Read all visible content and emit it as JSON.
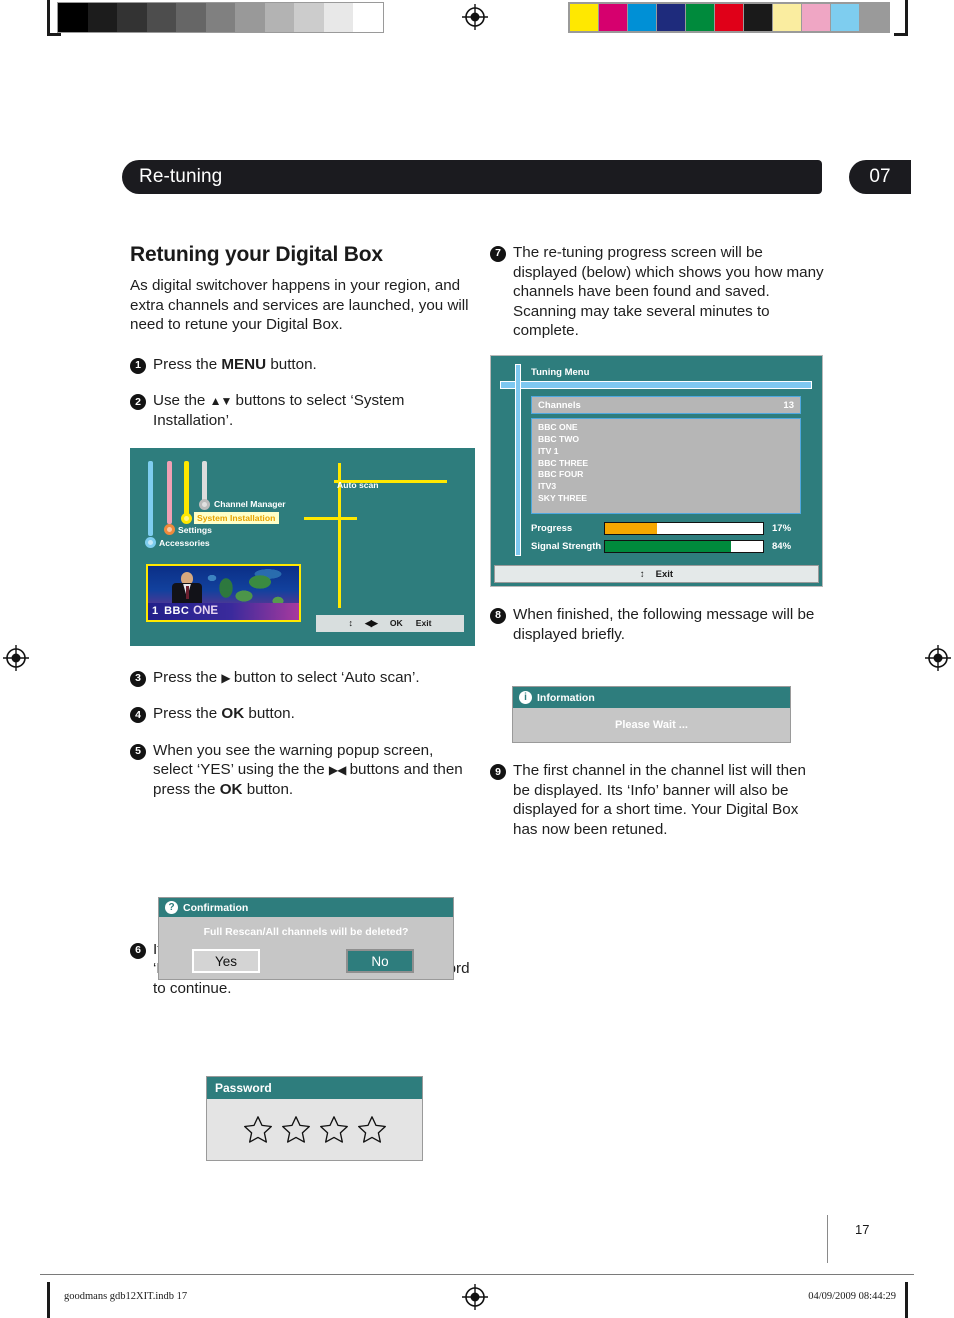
{
  "calibration": {
    "grayscale": [
      "#000000",
      "#1c1c1c",
      "#333333",
      "#4d4d4d",
      "#666666",
      "#808080",
      "#999999",
      "#b3b3b3",
      "#cccccc",
      "#e8e8e8",
      "#ffffff"
    ],
    "colors": [
      "#ffe800",
      "#d6006e",
      "#0090d6",
      "#1e2b7c",
      "#008a3c",
      "#e00018",
      "#1a1a1a",
      "#faeda0",
      "#efa6c4",
      "#7ecdef",
      "#9a9a9a"
    ]
  },
  "header": {
    "title": "Re-tuning",
    "page_badge": "07"
  },
  "left": {
    "section_title": "Retuning your Digital Box",
    "intro": "As digital switchover happens in your region, and extra channels and services are launched, you will need to retune your Digital Box.",
    "steps": [
      {
        "num": "1",
        "text_1": "Press the ",
        "bold": "MENU",
        "text_2": " button."
      },
      {
        "num": "2",
        "text_1": "Use the ",
        "glyphs": "▲▼",
        "text_2": " buttons to select ‘System Installation’."
      },
      {
        "num": "3",
        "text_1": "Press the ",
        "glyphs": "▶",
        "text_2": " button to select ‘Auto scan’."
      },
      {
        "num": "4",
        "text_1": "Press the ",
        "bold": "OK",
        "text_2": " button."
      },
      {
        "num": "5",
        "text_1": "When you see the warning popup screen, select ‘YES’ using the the ",
        "glyphs": "▶◀",
        "text_2": " buttons and then press the ",
        "bold": "OK",
        "text_3": " button."
      },
      {
        "num": "6",
        "text_1": "If ‘ Parental Lock has been set to ‘On’, the ‘Password’ box will display. Enter the password to continue."
      }
    ]
  },
  "osd_menu": {
    "items": [
      {
        "label": "Channel Manager",
        "selected": false,
        "bar_color": "#dcdcdc",
        "knob_color": "#bcbcbc"
      },
      {
        "label": "System Installation",
        "selected": true,
        "bar_color": "#ffe800",
        "knob_color": "#ffe800"
      },
      {
        "label": "Settings",
        "selected": false,
        "bar_color": "#f0a0b4",
        "knob_color": "#f08a3c"
      },
      {
        "label": "Accessories",
        "selected": false,
        "bar_color": "#7ecdef",
        "knob_color": "#7ecdef"
      }
    ],
    "submenu": "Auto scan",
    "navbar": {
      "updown": "↕",
      "leftright": "◀▶",
      "ok": "OK",
      "exit": "Exit"
    },
    "thumbnail": {
      "channel_number": "1",
      "brand": "BBC",
      "channel": "ONE"
    },
    "bg_color": "#2e7d7d",
    "highlight_bg": "#ffffc8",
    "highlight_fg": "#e8a200"
  },
  "confirmation": {
    "icon": "question-icon",
    "title": "Confirmation",
    "message": "Full Rescan/All channels will be deleted?",
    "yes_label": "Yes",
    "no_label": "No",
    "selected": "No"
  },
  "password": {
    "title": "Password",
    "digits": [
      "☆",
      "☆",
      "☆",
      "☆"
    ],
    "digit_count": 4
  },
  "right": {
    "steps": [
      {
        "num": "7",
        "text": "The re-tuning progress screen will be displayed (below) which shows you how many channels have been found and saved. Scanning may take several minutes to complete."
      },
      {
        "num": "8",
        "text": "When finished, the following message will be displayed briefly."
      },
      {
        "num": "9",
        "text": "The first channel in the channel list will then be displayed. Its ‘Info’ banner will also be displayed for a short time. Your Digital Box has now been retuned."
      }
    ]
  },
  "tuning_menu": {
    "title": "Tuning Menu",
    "channels_label": "Channels",
    "channels_count": "13",
    "channel_list": [
      "BBC ONE",
      "BBC TWO",
      "ITV 1",
      "BBC THREE",
      "BBC FOUR",
      "ITV3",
      "SKY THREE"
    ],
    "progress": {
      "label": "Progress",
      "value": "17%",
      "fill_fraction": 0.33,
      "color": "#f5a700"
    },
    "signal": {
      "label": "Signal Strength",
      "value": "84%",
      "fill_fraction": 0.8,
      "color": "#008a3c"
    },
    "exit_label": "Exit",
    "exit_glyph": "↕",
    "bg_color": "#2e7d7d",
    "panel_color": "#b6b6b6",
    "accent_color": "#4fa8e0"
  },
  "information": {
    "icon": "info-icon",
    "title": "Information",
    "message": "Please Wait ..."
  },
  "footer": {
    "file": "goodmans gdb12XIT.indb   17",
    "timestamp": "04/09/2009   08:44:29",
    "page_number": "17"
  }
}
